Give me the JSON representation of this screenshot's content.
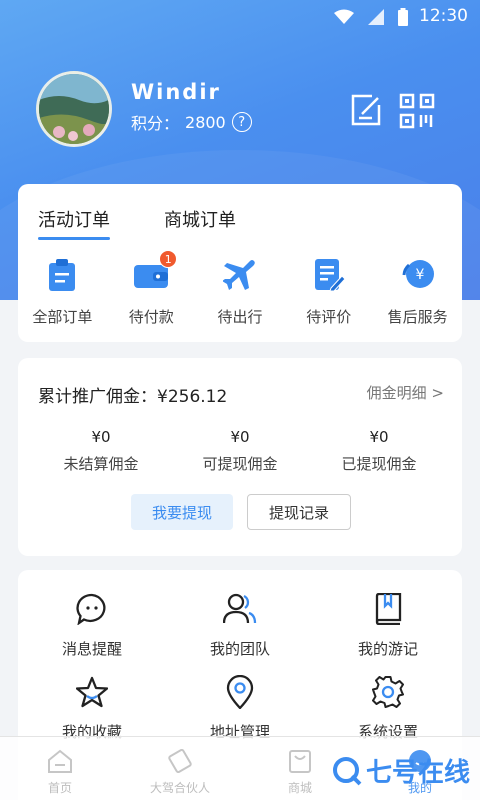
{
  "status_bar": {
    "time": "12:30",
    "icons": [
      "wifi-icon",
      "signal-icon",
      "battery-icon"
    ]
  },
  "profile": {
    "username": "Windir",
    "points_label": "积分：",
    "points_value": "2800",
    "help_glyph": "?"
  },
  "header_actions": [
    "edit-icon",
    "qr-code-icon"
  ],
  "orders": {
    "tabs": [
      {
        "label": "活动订单",
        "active": true
      },
      {
        "label": "商城订单",
        "active": false
      }
    ],
    "items": [
      {
        "label": "全部订单",
        "icon": "clipboard-icon"
      },
      {
        "label": "待付款",
        "icon": "wallet-icon",
        "badge": "1"
      },
      {
        "label": "待出行",
        "icon": "airplane-icon"
      },
      {
        "label": "待评价",
        "icon": "review-edit-icon"
      },
      {
        "label": "售后服务",
        "icon": "after-sales-icon",
        "glyph": "¥"
      }
    ]
  },
  "commission": {
    "title": "累计推广佣金：¥256.12",
    "detail_link": "佣金明细 >",
    "stats": [
      {
        "value": "¥0",
        "label": "未结算佣金"
      },
      {
        "value": "¥0",
        "label": "可提现佣金"
      },
      {
        "value": "¥0",
        "label": "已提现佣金"
      }
    ],
    "withdraw_button": "我要提现",
    "records_button": "提现记录"
  },
  "menu": [
    {
      "label": "消息提醒",
      "icon": "message-icon"
    },
    {
      "label": "我的团队",
      "icon": "team-icon"
    },
    {
      "label": "我的游记",
      "icon": "travel-notes-icon"
    },
    {
      "label": "我的收藏",
      "icon": "star-icon"
    },
    {
      "label": "地址管理",
      "icon": "location-icon"
    },
    {
      "label": "系统设置",
      "icon": "settings-icon"
    }
  ],
  "bottom_nav": [
    {
      "label": "首页",
      "icon": "home-icon",
      "active": false
    },
    {
      "label": "大驾合伙人",
      "icon": "partner-icon",
      "active": false
    },
    {
      "label": "商城",
      "icon": "shop-bag-icon",
      "active": false
    },
    {
      "label": "我的",
      "icon": "profile-icon",
      "active": true
    }
  ],
  "watermark": "七号在线",
  "colors": {
    "accent": "#3b8cf0",
    "header_gradient_start": "#5fa8f3",
    "header_gradient_end": "#4a7fe9",
    "badge": "#f05a2e"
  }
}
